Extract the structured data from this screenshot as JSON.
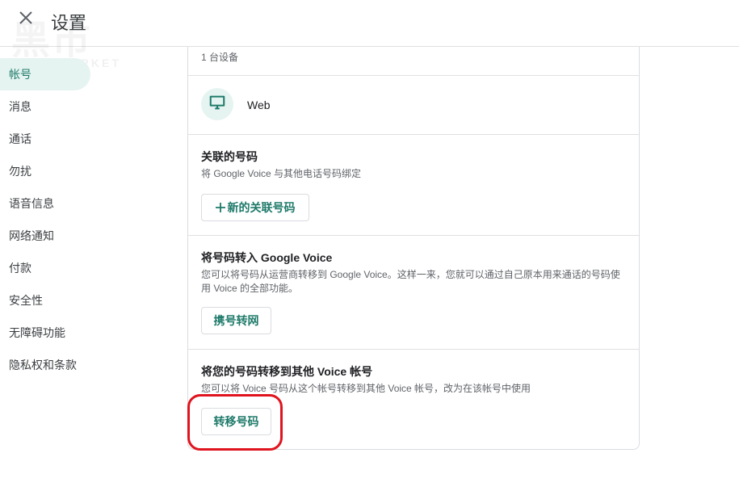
{
  "header": {
    "title": "设置"
  },
  "watermark": {
    "big": "黑市",
    "small": "BLACKMARKET"
  },
  "sidebar": {
    "items": [
      {
        "label": "帐号",
        "active": true
      },
      {
        "label": "消息"
      },
      {
        "label": "通话"
      },
      {
        "label": "勿扰"
      },
      {
        "label": "语音信息"
      },
      {
        "label": "网络通知"
      },
      {
        "label": "付款"
      },
      {
        "label": "安全性"
      },
      {
        "label": "无障碍功能"
      },
      {
        "label": "隐私权和条款"
      }
    ]
  },
  "devices": {
    "count_text": "1 台设备",
    "items": [
      {
        "label": "Web",
        "icon": "monitor-icon"
      }
    ]
  },
  "linked_numbers": {
    "title": "关联的号码",
    "description": "将 Google Voice 与其他电话号码绑定",
    "button_label": "新的关联号码"
  },
  "port_in": {
    "title": "将号码转入 Google Voice",
    "description": "您可以将号码从运营商转移到 Google Voice。这样一来，您就可以通过自己原本用来通话的号码使用 Voice 的全部功能。",
    "button_label": "携号转网"
  },
  "transfer": {
    "title": "将您的号码转移到其他 Voice 帐号",
    "description": "您可以将 Voice 号码从这个帐号转移到其他 Voice 帐号，改为在该帐号中使用",
    "button_label": "转移号码"
  },
  "colors": {
    "accent": "#1e7a6a",
    "highlight": "#e0141e",
    "active_bg": "#e6f4f1"
  }
}
